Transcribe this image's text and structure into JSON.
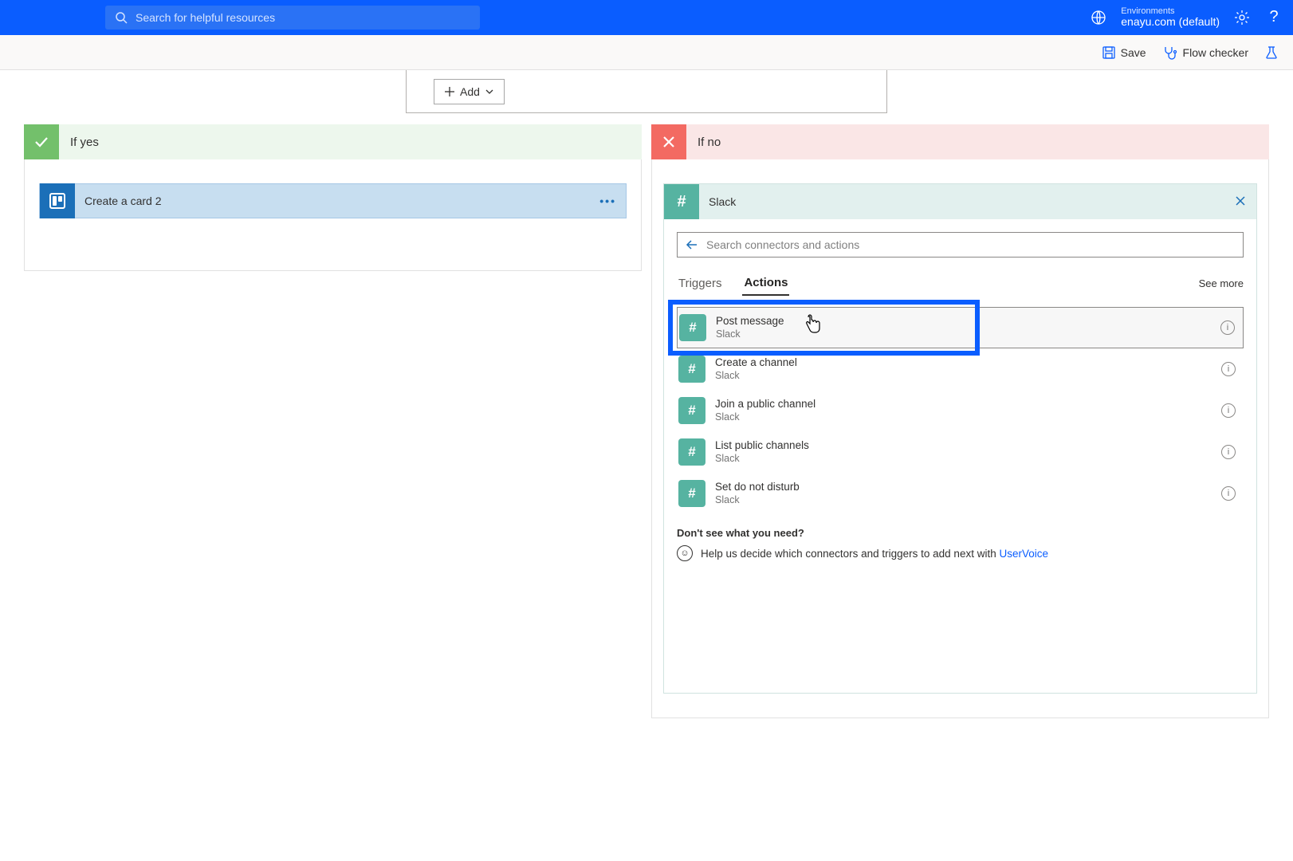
{
  "header": {
    "search_placeholder": "Search for helpful resources",
    "env_label": "Environments",
    "env_name": "enayu.com (default)"
  },
  "toolbar": {
    "save": "Save",
    "flow_checker": "Flow checker"
  },
  "condition": {
    "add_label": "Add"
  },
  "yes_branch": {
    "title": "If yes",
    "step_title": "Create a card 2"
  },
  "no_branch": {
    "title": "If no",
    "connector_title": "Slack",
    "search_placeholder": "Search connectors and actions",
    "tab_triggers": "Triggers",
    "tab_actions": "Actions",
    "see_more": "See more",
    "actions": [
      {
        "title": "Post message",
        "sub": "Slack",
        "selected": true
      },
      {
        "title": "Create a channel",
        "sub": "Slack",
        "selected": false
      },
      {
        "title": "Join a public channel",
        "sub": "Slack",
        "selected": false
      },
      {
        "title": "List public channels",
        "sub": "Slack",
        "selected": false
      },
      {
        "title": "Set do not disturb",
        "sub": "Slack",
        "selected": false
      }
    ],
    "need_title": "Don't see what you need?",
    "need_text": "Help us decide which connectors and triggers to add next with ",
    "need_link": "UserVoice"
  }
}
